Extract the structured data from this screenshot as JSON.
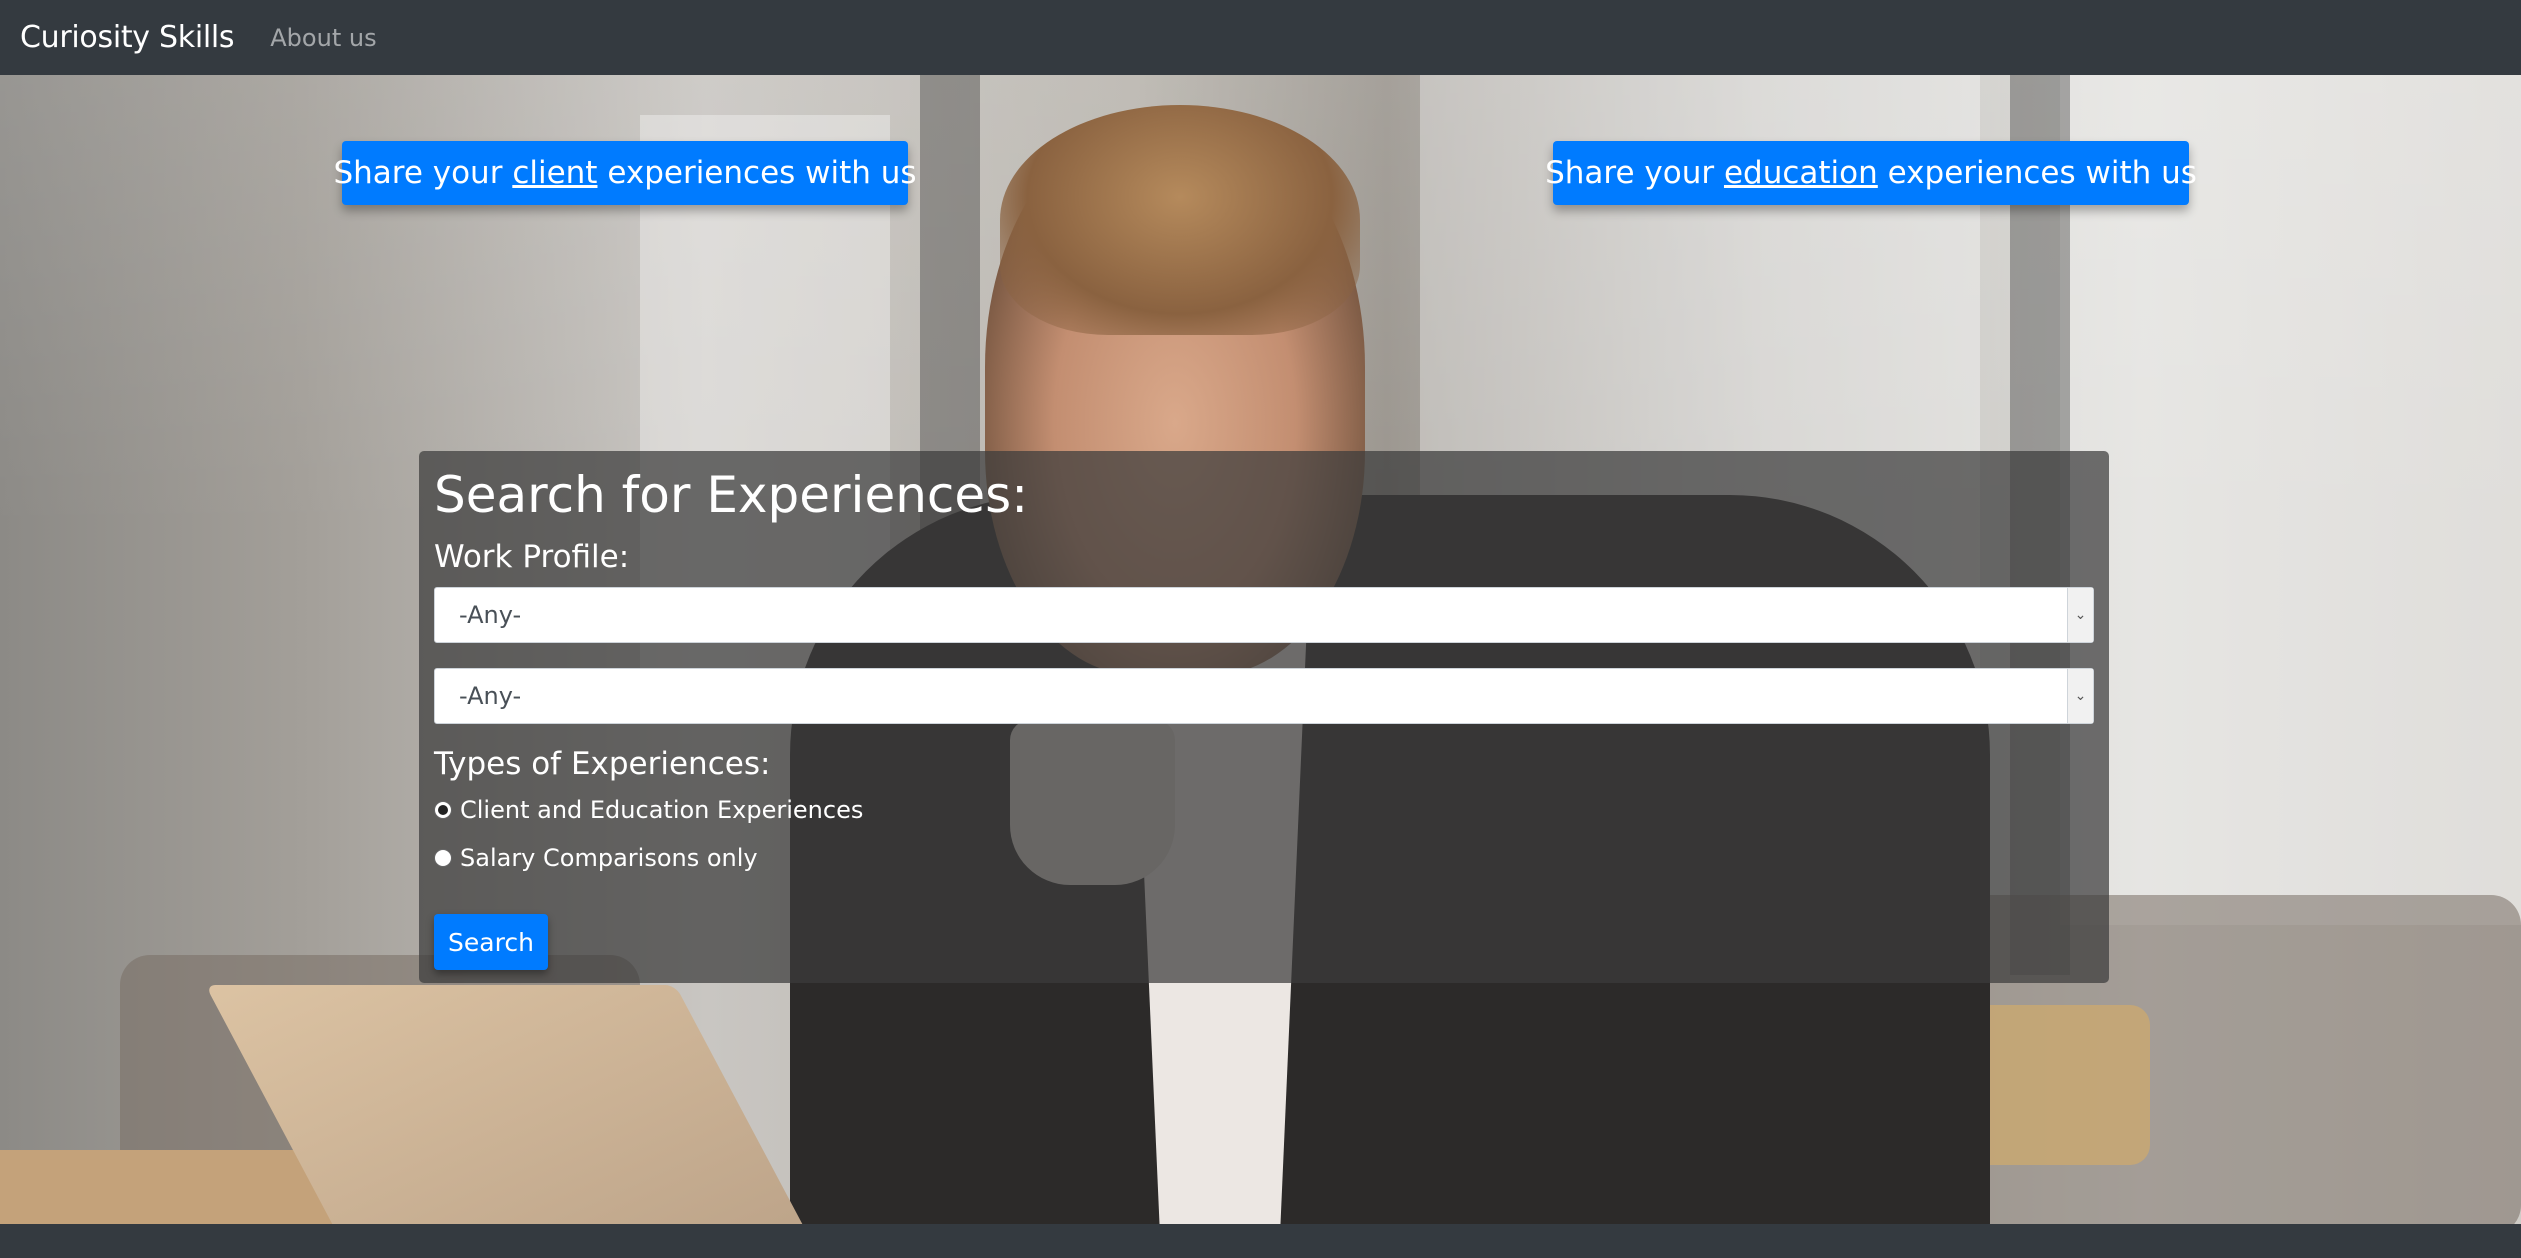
{
  "navbar": {
    "brand": "Curiosity Skills",
    "links": [
      "About us"
    ]
  },
  "share": {
    "client": {
      "prefix": "Share your ",
      "keyword": "client",
      "suffix": " experiences with us"
    },
    "education": {
      "prefix": "Share your ",
      "keyword": "education",
      "suffix": " experiences with us"
    }
  },
  "search_panel": {
    "title": "Search for Experiences:",
    "work_profile_label": "Work Profile:",
    "work_profile_value": "-Any-",
    "second_select_value": "-Any-",
    "types_label": "Types of Experiences:",
    "options": [
      {
        "label": "Client and Education Experiences",
        "checked": true
      },
      {
        "label": "Salary Comparisons only",
        "checked": false
      }
    ],
    "search_button": "Search"
  },
  "colors": {
    "navbar": "#343a40",
    "primary": "#007bff",
    "panel": "rgba(60,60,60,0.72)"
  },
  "icons": {
    "select_arrow": "chevron-down-icon"
  }
}
